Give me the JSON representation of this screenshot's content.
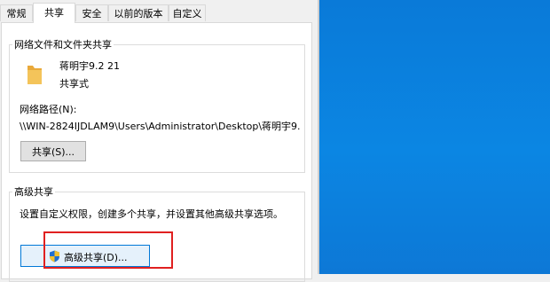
{
  "tabs": [
    {
      "label": "常规",
      "active": false
    },
    {
      "label": "共享",
      "active": true
    },
    {
      "label": "安全",
      "active": false
    },
    {
      "label": "以前的版本",
      "active": false
    },
    {
      "label": "自定义",
      "active": false
    }
  ],
  "network_share": {
    "group_title": "网络文件和文件夹共享",
    "folder_name": "蒋明宇9.2 21",
    "share_status": "共享式",
    "path_label": "网络路径(N):",
    "path_value": "\\\\WIN-2824IJDLAM9\\Users\\Administrator\\Desktop\\蒋明宇9.",
    "share_button": "共享(S)..."
  },
  "advanced_share": {
    "group_title": "高级共享",
    "description": "设置自定义权限，创建多个共享，并设置其他高级共享选项。",
    "button": "高级共享(D)..."
  },
  "colors": {
    "highlight_box": "#e02020",
    "desktop": "#0b86e3",
    "folder": "#f4c45a"
  }
}
